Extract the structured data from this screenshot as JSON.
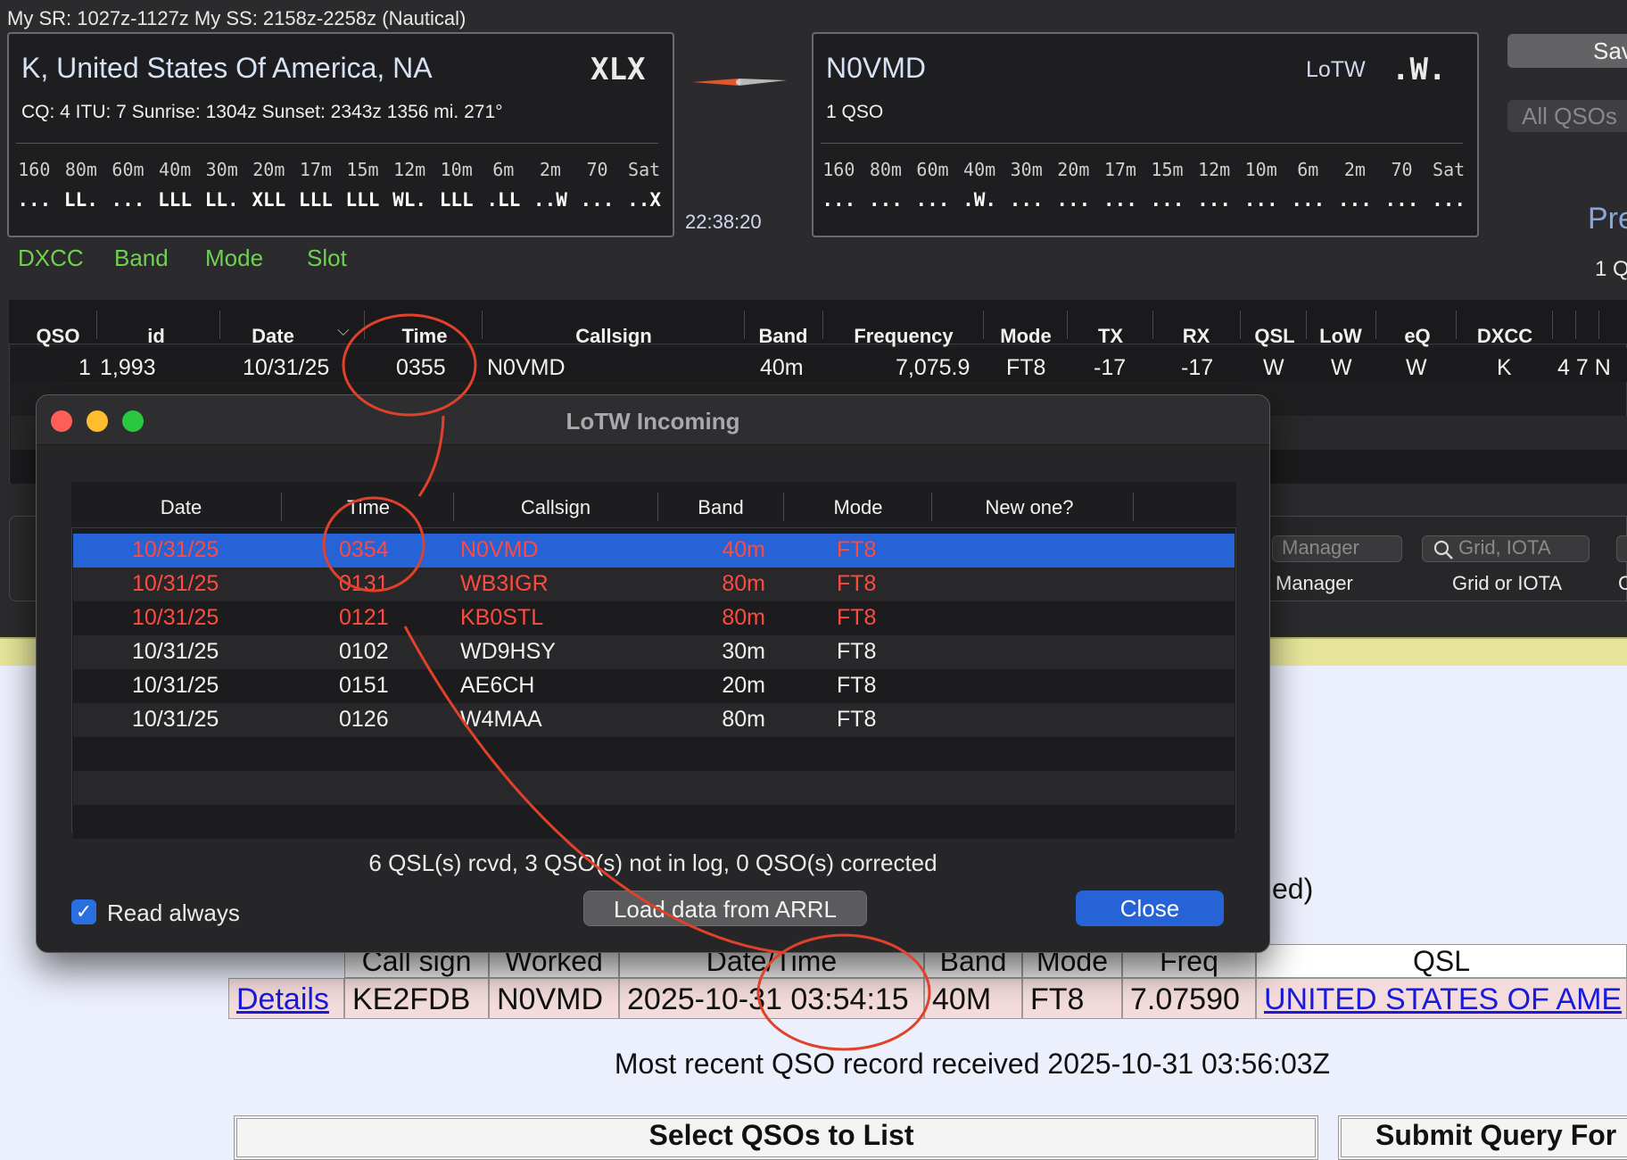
{
  "app": {
    "sr_line": "My SR: 1027z-1127z  My SS: 2158z-2258z (Nautical)",
    "left_panel": {
      "title": "K, United States Of America, NA",
      "badge": "XLX",
      "info": "CQ: 4  ITU: 7  Sunrise: 1304z  Sunset: 2343z  1356 mi.  271°",
      "bands": [
        "160",
        "80m",
        "60m",
        "40m",
        "30m",
        "20m",
        "17m",
        "15m",
        "12m",
        "10m",
        "6m",
        "2m",
        "70",
        "Sat"
      ],
      "status": [
        "...",
        "LL.",
        "...",
        "LLL",
        "LL.",
        "XLL",
        "LLL",
        "LLL",
        "WL.",
        "LLL",
        ".LL",
        "..W",
        "...",
        "..X"
      ]
    },
    "clock": "22:38:20",
    "right_panel": {
      "title": "N0VMD",
      "lotw_label": "LoTW",
      "badge": ".W.",
      "info": "1 QSO",
      "bands": [
        "160",
        "80m",
        "60m",
        "40m",
        "30m",
        "20m",
        "17m",
        "15m",
        "12m",
        "10m",
        "6m",
        "2m",
        "70",
        "Sat"
      ],
      "status": [
        "...",
        "...",
        "...",
        ".W.",
        "...",
        "...",
        "...",
        "...",
        "...",
        "...",
        "...",
        "...",
        "...",
        "..."
      ]
    },
    "side": {
      "save_label": "Sav",
      "all_qsos_label": "All QSOs",
      "pre_label": "Pre",
      "count_label": "1 Q"
    },
    "tabs": [
      "DXCC",
      "Band",
      "Mode",
      "Slot"
    ],
    "table": {
      "headers": [
        "QSO",
        "id",
        "Date",
        "Time",
        "Callsign",
        "Band",
        "Frequency",
        "Mode",
        "TX",
        "RX",
        "QSL",
        "LoW",
        "eQ",
        "DXCC"
      ],
      "row": {
        "qso": "1",
        "id": "1,993",
        "date": "10/31/25",
        "time": "0355",
        "callsign": "N0VMD",
        "band": "40m",
        "frequency": "7,075.9",
        "mode": "FT8",
        "tx": "-17",
        "rx": "-17",
        "qsl": "W",
        "low": "W",
        "eq": "W",
        "dxcc": "K",
        "extra": "4 7 N"
      }
    },
    "search": {
      "manager_placeholder": "Manager",
      "manager_label": "Manager",
      "grid_placeholder": "Grid, IOTA",
      "grid_label": "Grid or IOTA",
      "edge_label": "C"
    }
  },
  "dialog": {
    "title": "LoTW Incoming",
    "headers": [
      "Date",
      "Time",
      "Callsign",
      "Band",
      "Mode",
      "New one?"
    ],
    "rows": [
      {
        "date": "10/31/25",
        "time": "0354",
        "callsign": "N0VMD",
        "band": "40m",
        "mode": "FT8",
        "new": "",
        "state": "selected"
      },
      {
        "date": "10/31/25",
        "time": "0131",
        "callsign": "WB3IGR",
        "band": "80m",
        "mode": "FT8",
        "new": "",
        "state": "missing"
      },
      {
        "date": "10/31/25",
        "time": "0121",
        "callsign": "KB0STL",
        "band": "80m",
        "mode": "FT8",
        "new": "",
        "state": "missing"
      },
      {
        "date": "10/31/25",
        "time": "0102",
        "callsign": "WD9HSY",
        "band": "30m",
        "mode": "FT8",
        "new": "",
        "state": "normal"
      },
      {
        "date": "10/31/25",
        "time": "0151",
        "callsign": "AE6CH",
        "band": "20m",
        "mode": "FT8",
        "new": "",
        "state": "normal"
      },
      {
        "date": "10/31/25",
        "time": "0126",
        "callsign": "W4MAA",
        "band": "80m",
        "mode": "FT8",
        "new": "",
        "state": "normal"
      }
    ],
    "status": "6 QSL(s) rcvd, 3 QSO(s) not in log, 0 QSO(s) corrected",
    "read_always_label": "Read always",
    "load_label": "Load data from ARRL",
    "close_label": "Close"
  },
  "web": {
    "partial_text": "ed)",
    "headers": [
      "Call sign",
      "Worked",
      "Date/Time",
      "Band",
      "Mode",
      "Freq",
      "QSL"
    ],
    "row": {
      "link": "Details",
      "call": "KE2FDB",
      "worked": "N0VMD",
      "datetime": "2025-10-31 03:54:15",
      "band": "40M",
      "mode": "FT8",
      "freq": "7.07590",
      "qsl": "UNITED STATES OF AME"
    },
    "recent": "Most recent QSO record received 2025-10-31 03:56:03Z",
    "select_header": "Select QSOs to List",
    "submit_header": "Submit Query For"
  },
  "colors": {
    "accent_blue": "#2563d6",
    "tab_green": "#6fd24f",
    "missing_red": "#ff4a3d",
    "annotation_red": "#e0412b",
    "link_blue": "#1a1adb"
  }
}
